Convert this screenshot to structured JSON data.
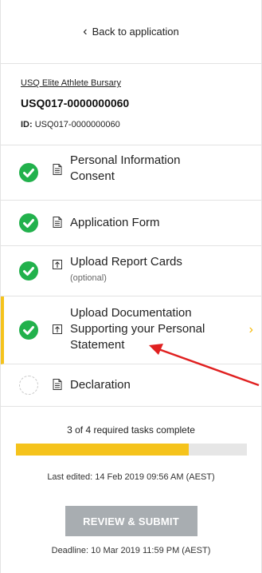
{
  "nav": {
    "back_label": "Back to application"
  },
  "application": {
    "name": "USQ Elite Athlete Bursary",
    "number": "USQ017-0000000060",
    "id_label": "ID:",
    "id_value": "USQ017-0000000060"
  },
  "tasks": [
    {
      "line1": "Personal Information",
      "line2": "Consent",
      "sub": "",
      "status": "complete",
      "icon": "document-icon"
    },
    {
      "line1": "Application Form",
      "line2": "",
      "sub": "",
      "status": "complete",
      "icon": "document-icon"
    },
    {
      "line1": "Upload Report Cards",
      "line2": "",
      "sub": "(optional)",
      "status": "complete",
      "icon": "upload-icon"
    },
    {
      "line1": "Upload Documentation",
      "line2": "Supporting your Personal",
      "line3": "Statement",
      "sub": "",
      "status": "complete",
      "icon": "upload-icon",
      "active": true
    },
    {
      "line1": "Declaration",
      "line2": "",
      "sub": "",
      "status": "incomplete",
      "icon": "document-icon"
    }
  ],
  "progress": {
    "text": "3 of 4 required tasks complete",
    "fraction": 0.75
  },
  "last_edited": "Last edited: 14 Feb 2019 09:56 AM (AEST)",
  "submit_label": "REVIEW & SUBMIT",
  "deadline": "Deadline: 10 Mar 2019 11:59 PM (AEST)",
  "colors": {
    "complete": "#22b14c",
    "accent": "#f5c31c",
    "button": "#a8adb1",
    "annotation_arrow": "#e02020"
  }
}
